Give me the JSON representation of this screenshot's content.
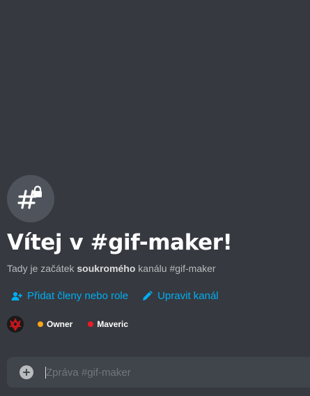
{
  "channel": {
    "name": "#gif-maker",
    "icon": "hashtag-lock-icon"
  },
  "welcome": {
    "title": "Vítej v #gif-maker!",
    "subtitle_prefix": "Tady je začátek ",
    "subtitle_bold": "soukromého",
    "subtitle_suffix": " kanálu #gif-maker"
  },
  "actions": {
    "add_members_label": "Přidat členy nebo role",
    "add_members_icon": "add-member-icon",
    "edit_channel_label": "Upravit kanál",
    "edit_channel_icon": "pencil-icon",
    "accent_color": "#00aff4"
  },
  "members": {
    "avatar": "red-emblem-avatar",
    "roles": [
      {
        "name": "Owner",
        "color": "#faa61a"
      },
      {
        "name": "Maveric",
        "color": "#ed1c24"
      }
    ]
  },
  "composer": {
    "placeholder": "Zpráva #gif-maker",
    "value": "",
    "add_icon": "plus-circle-icon"
  }
}
